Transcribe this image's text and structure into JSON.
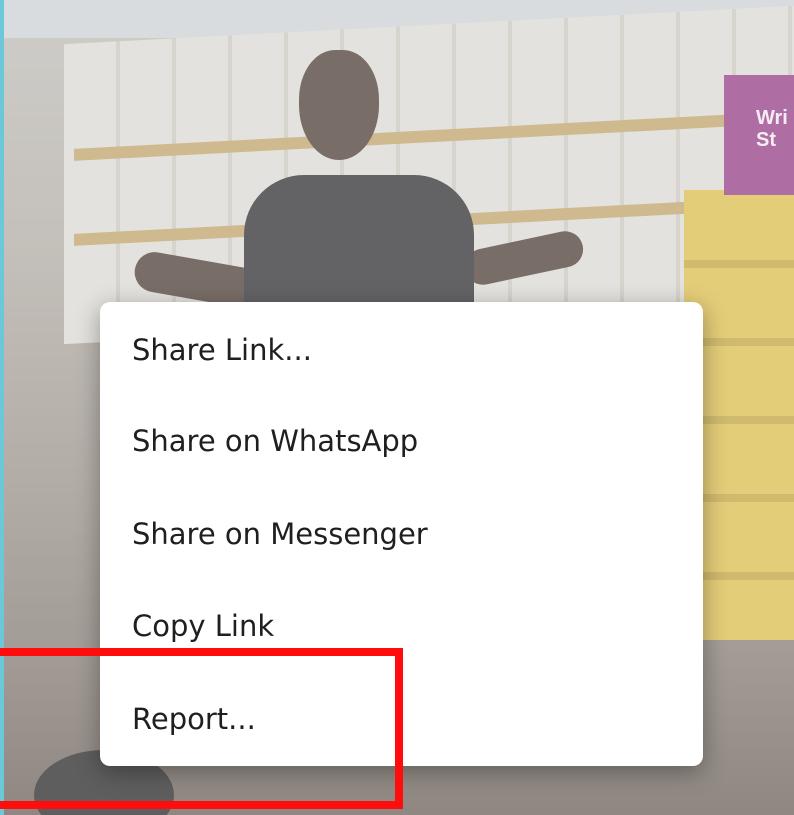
{
  "background": {
    "description_colors": {
      "accent_border": "#6cc8d8",
      "highlight_box": "#ff0d0d"
    },
    "sign_text": "Wri St"
  },
  "menu": {
    "items": [
      {
        "label": "Share Link..."
      },
      {
        "label": "Share on WhatsApp"
      },
      {
        "label": "Share on Messenger"
      },
      {
        "label": "Copy Link"
      },
      {
        "label": "Report..."
      }
    ]
  }
}
